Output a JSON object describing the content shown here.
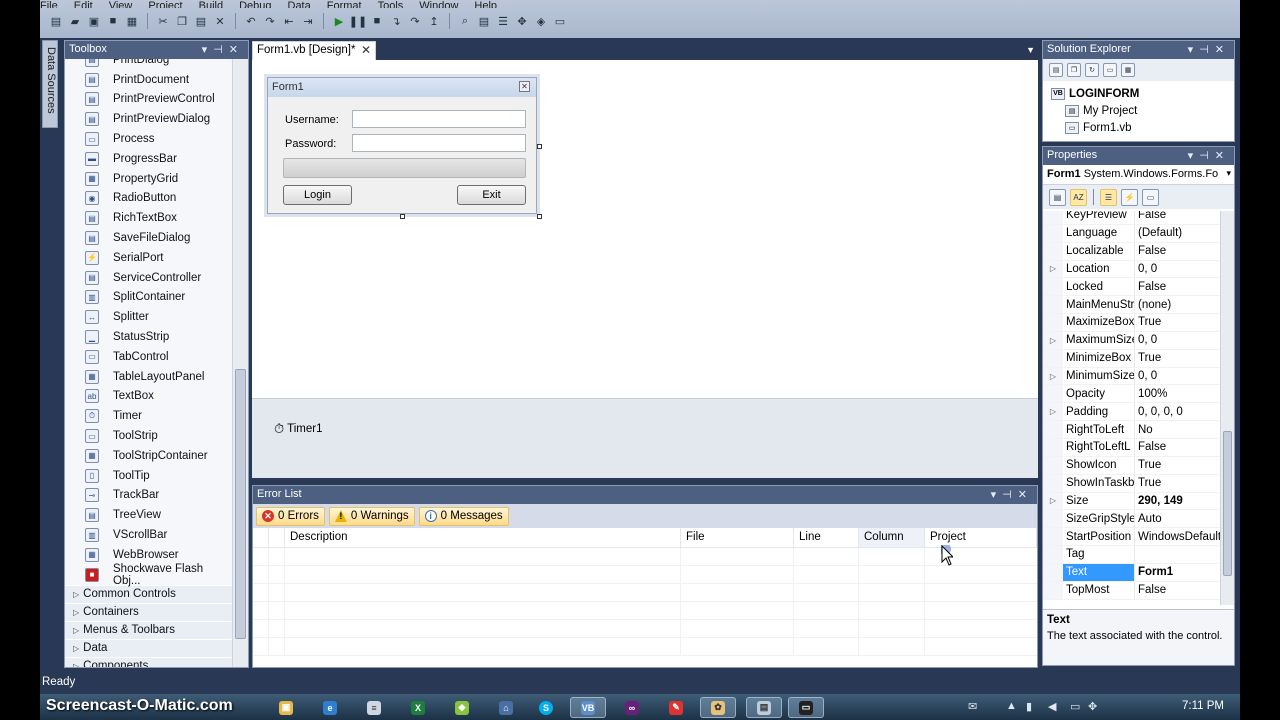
{
  "menu": [
    "File",
    "Edit",
    "View",
    "Project",
    "Build",
    "Debug",
    "Data",
    "Format",
    "Tools",
    "Window",
    "Help"
  ],
  "data_sources_tab": "Data Sources",
  "toolbox": {
    "title": "Toolbox",
    "items": [
      {
        "label": "PrintDialog",
        "icon": "print-dialog-icon"
      },
      {
        "label": "PrintDocument",
        "icon": "print-document-icon"
      },
      {
        "label": "PrintPreviewControl",
        "icon": "print-preview-control-icon"
      },
      {
        "label": "PrintPreviewDialog",
        "icon": "print-preview-dialog-icon"
      },
      {
        "label": "Process",
        "icon": "process-icon"
      },
      {
        "label": "ProgressBar",
        "icon": "progressbar-icon"
      },
      {
        "label": "PropertyGrid",
        "icon": "propertygrid-icon"
      },
      {
        "label": "RadioButton",
        "icon": "radiobutton-icon"
      },
      {
        "label": "RichTextBox",
        "icon": "richtextbox-icon"
      },
      {
        "label": "SaveFileDialog",
        "icon": "savefiledialog-icon"
      },
      {
        "label": "SerialPort",
        "icon": "serialport-icon"
      },
      {
        "label": "ServiceController",
        "icon": "servicecontroller-icon"
      },
      {
        "label": "SplitContainer",
        "icon": "splitcontainer-icon"
      },
      {
        "label": "Splitter",
        "icon": "splitter-icon"
      },
      {
        "label": "StatusStrip",
        "icon": "statusstrip-icon"
      },
      {
        "label": "TabControl",
        "icon": "tabcontrol-icon"
      },
      {
        "label": "TableLayoutPanel",
        "icon": "tablelayoutpanel-icon"
      },
      {
        "label": "TextBox",
        "icon": "textbox-icon"
      },
      {
        "label": "Timer",
        "icon": "timer-icon"
      },
      {
        "label": "ToolStrip",
        "icon": "toolstrip-icon"
      },
      {
        "label": "ToolStripContainer",
        "icon": "toolstripcontainer-icon"
      },
      {
        "label": "ToolTip",
        "icon": "tooltip-icon"
      },
      {
        "label": "TrackBar",
        "icon": "trackbar-icon"
      },
      {
        "label": "TreeView",
        "icon": "treeview-icon"
      },
      {
        "label": "VScrollBar",
        "icon": "vscrollbar-icon"
      },
      {
        "label": "WebBrowser",
        "icon": "webbrowser-icon"
      },
      {
        "label": "Shockwave Flash Obj...",
        "icon": "shockwave-flash-icon"
      }
    ],
    "categories": [
      "Common Controls",
      "Containers",
      "Menus & Toolbars",
      "Data",
      "Components"
    ]
  },
  "document_tab": {
    "label": "Form1.vb [Design]*"
  },
  "form": {
    "title": "Form1",
    "username_label": "Username:",
    "password_label": "Password:",
    "username_value": "",
    "password_value": "",
    "login_button": "Login",
    "exit_button": "Exit"
  },
  "component_tray": {
    "timer_label": "Timer1"
  },
  "error_list": {
    "title": "Error List",
    "errors_label": "0 Errors",
    "warnings_label": "0 Warnings",
    "messages_label": "0 Messages",
    "columns": [
      "Description",
      "File",
      "Line",
      "Column",
      "Project"
    ]
  },
  "solution_explorer": {
    "title": "Solution Explorer",
    "root": "LOGINFORM",
    "items": [
      "My Project",
      "Form1.vb"
    ]
  },
  "properties": {
    "title": "Properties",
    "object_name": "Form1",
    "object_type": "System.Windows.Forms.Fo",
    "rows": [
      {
        "name": "KeyPreview",
        "value": "False",
        "expandable": false
      },
      {
        "name": "Language",
        "value": "(Default)",
        "expandable": false
      },
      {
        "name": "Localizable",
        "value": "False",
        "expandable": false
      },
      {
        "name": "Location",
        "value": "0, 0",
        "expandable": true
      },
      {
        "name": "Locked",
        "value": "False",
        "expandable": false
      },
      {
        "name": "MainMenuStr",
        "value": "(none)",
        "expandable": false
      },
      {
        "name": "MaximizeBox",
        "value": "True",
        "expandable": false
      },
      {
        "name": "MaximumSize",
        "value": "0, 0",
        "expandable": true
      },
      {
        "name": "MinimizeBox",
        "value": "True",
        "expandable": false
      },
      {
        "name": "MinimumSize",
        "value": "0, 0",
        "expandable": true
      },
      {
        "name": "Opacity",
        "value": "100%",
        "expandable": false
      },
      {
        "name": "Padding",
        "value": "0, 0, 0, 0",
        "expandable": true
      },
      {
        "name": "RightToLeft",
        "value": "No",
        "expandable": false
      },
      {
        "name": "RightToLeftL",
        "value": "False",
        "expandable": false
      },
      {
        "name": "ShowIcon",
        "value": "True",
        "expandable": false
      },
      {
        "name": "ShowInTaskb",
        "value": "True",
        "expandable": false
      },
      {
        "name": "Size",
        "value": "290, 149",
        "expandable": true,
        "bold": true
      },
      {
        "name": "SizeGripStyle",
        "value": "Auto",
        "expandable": false
      },
      {
        "name": "StartPosition",
        "value": "WindowsDefault",
        "expandable": false
      },
      {
        "name": "Tag",
        "value": "",
        "expandable": false
      },
      {
        "name": "Text",
        "value": "Form1",
        "expandable": false,
        "bold": true,
        "selected": true
      },
      {
        "name": "TopMost",
        "value": "False",
        "expandable": false
      }
    ],
    "description_title": "Text",
    "description_text": "The text associated with the control."
  },
  "status_bar": {
    "text": "Ready"
  },
  "taskbar": {
    "clock": "7:11 PM",
    "watermark": "Screencast-O-Matic.com",
    "apps": [
      "windows-explorer-icon",
      "ie-icon",
      "notepad-icon",
      "excel-icon",
      "android-icon",
      "app-icon",
      "skype-icon",
      "vb-designer-icon",
      "visual-studio-icon",
      "shell-icon",
      "paint-icon",
      "notepad2-icon",
      "cmd-icon"
    ]
  },
  "colors": {
    "ide_background": "#293955",
    "panel_title": "#4d6082",
    "selection": "#3399ff",
    "error_button": "#ffd98a"
  }
}
